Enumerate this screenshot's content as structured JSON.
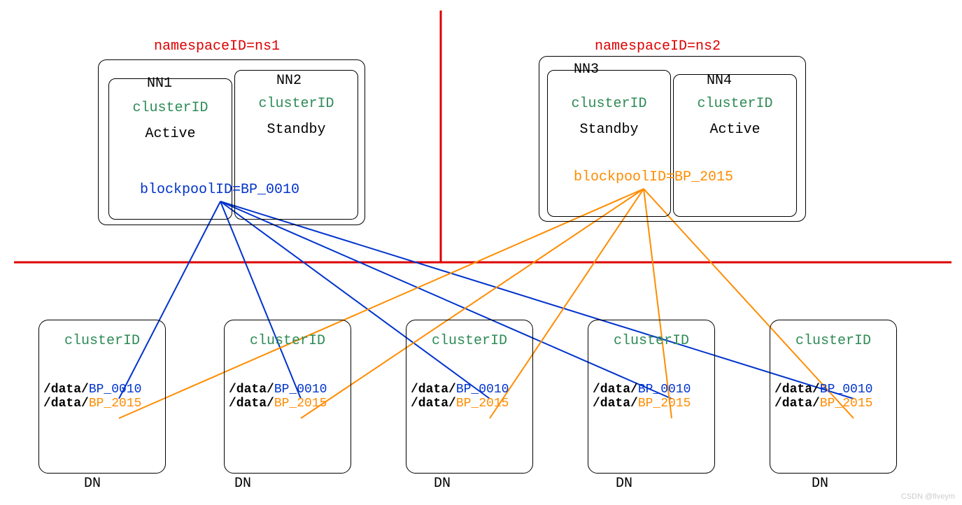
{
  "ns1": {
    "label": "namespaceID=ns1"
  },
  "ns2": {
    "label": "namespaceID=ns2"
  },
  "nn1": {
    "name": "NN1",
    "cluster": "clusterID",
    "state": "Active"
  },
  "nn2": {
    "name": "NN2",
    "cluster": "clusterID",
    "state": "Standby"
  },
  "nn3": {
    "name": "NN3",
    "cluster": "clusterID",
    "state": "Standby"
  },
  "nn4": {
    "name": "NN4",
    "cluster": "clusterID",
    "state": "Active"
  },
  "bp1": {
    "label": "blockpoolID=BP_0010"
  },
  "bp2": {
    "label": "blockpoolID=BP_2015"
  },
  "dn": {
    "cluster": "clusterID",
    "prefix": "/data/",
    "bp0010": "BP_0010",
    "bp2015": "BP_2015",
    "label": "DN"
  },
  "watermark": "CSDN @fiveym"
}
